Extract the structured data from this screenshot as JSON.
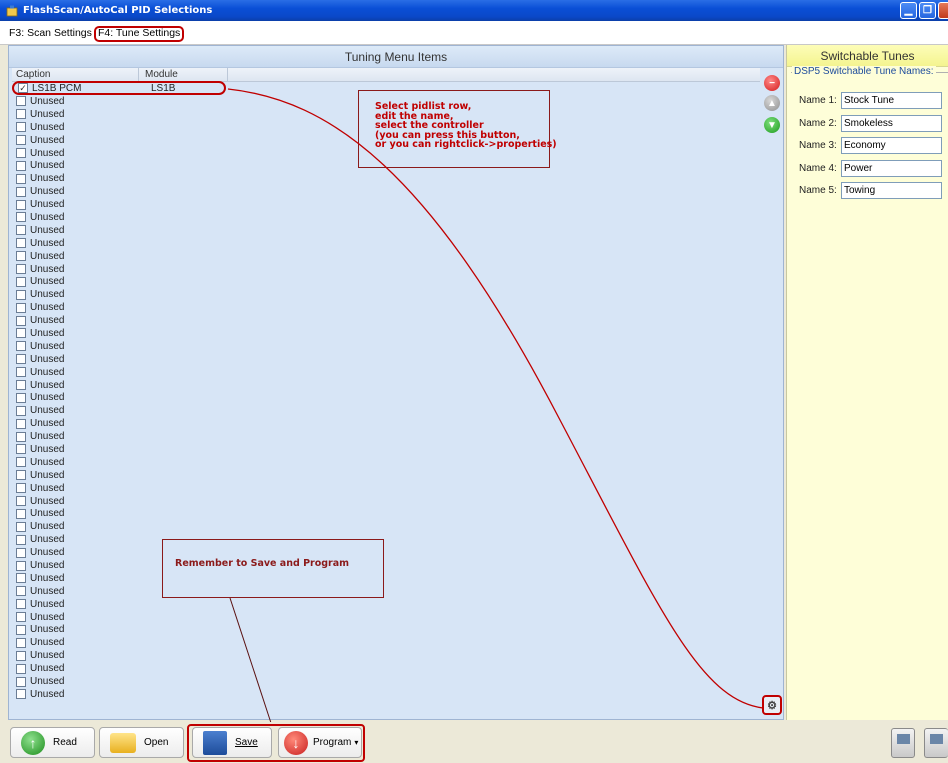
{
  "window": {
    "title": "FlashScan/AutoCal PID Selections"
  },
  "tabs": [
    {
      "label": "F3: Scan Settings"
    },
    {
      "label": "F4: Tune Settings"
    }
  ],
  "tuning_panel": {
    "title": "Tuning Menu Items",
    "columns": [
      "Caption",
      "Module"
    ],
    "rows": [
      {
        "checked": true,
        "caption": "LS1B PCM",
        "module": "LS1B"
      },
      {
        "checked": false,
        "caption": "Unused",
        "module": ""
      },
      {
        "checked": false,
        "caption": "Unused",
        "module": ""
      },
      {
        "checked": false,
        "caption": "Unused",
        "module": ""
      },
      {
        "checked": false,
        "caption": "Unused",
        "module": ""
      },
      {
        "checked": false,
        "caption": "Unused",
        "module": ""
      },
      {
        "checked": false,
        "caption": "Unused",
        "module": ""
      },
      {
        "checked": false,
        "caption": "Unused",
        "module": ""
      },
      {
        "checked": false,
        "caption": "Unused",
        "module": ""
      },
      {
        "checked": false,
        "caption": "Unused",
        "module": ""
      },
      {
        "checked": false,
        "caption": "Unused",
        "module": ""
      },
      {
        "checked": false,
        "caption": "Unused",
        "module": ""
      },
      {
        "checked": false,
        "caption": "Unused",
        "module": ""
      },
      {
        "checked": false,
        "caption": "Unused",
        "module": ""
      },
      {
        "checked": false,
        "caption": "Unused",
        "module": ""
      },
      {
        "checked": false,
        "caption": "Unused",
        "module": ""
      },
      {
        "checked": false,
        "caption": "Unused",
        "module": ""
      },
      {
        "checked": false,
        "caption": "Unused",
        "module": ""
      },
      {
        "checked": false,
        "caption": "Unused",
        "module": ""
      },
      {
        "checked": false,
        "caption": "Unused",
        "module": ""
      },
      {
        "checked": false,
        "caption": "Unused",
        "module": ""
      },
      {
        "checked": false,
        "caption": "Unused",
        "module": ""
      },
      {
        "checked": false,
        "caption": "Unused",
        "module": ""
      },
      {
        "checked": false,
        "caption": "Unused",
        "module": ""
      },
      {
        "checked": false,
        "caption": "Unused",
        "module": ""
      },
      {
        "checked": false,
        "caption": "Unused",
        "module": ""
      },
      {
        "checked": false,
        "caption": "Unused",
        "module": ""
      },
      {
        "checked": false,
        "caption": "Unused",
        "module": ""
      },
      {
        "checked": false,
        "caption": "Unused",
        "module": ""
      },
      {
        "checked": false,
        "caption": "Unused",
        "module": ""
      },
      {
        "checked": false,
        "caption": "Unused",
        "module": ""
      },
      {
        "checked": false,
        "caption": "Unused",
        "module": ""
      },
      {
        "checked": false,
        "caption": "Unused",
        "module": ""
      },
      {
        "checked": false,
        "caption": "Unused",
        "module": ""
      },
      {
        "checked": false,
        "caption": "Unused",
        "module": ""
      },
      {
        "checked": false,
        "caption": "Unused",
        "module": ""
      },
      {
        "checked": false,
        "caption": "Unused",
        "module": ""
      },
      {
        "checked": false,
        "caption": "Unused",
        "module": ""
      },
      {
        "checked": false,
        "caption": "Unused",
        "module": ""
      },
      {
        "checked": false,
        "caption": "Unused",
        "module": ""
      },
      {
        "checked": false,
        "caption": "Unused",
        "module": ""
      },
      {
        "checked": false,
        "caption": "Unused",
        "module": ""
      },
      {
        "checked": false,
        "caption": "Unused",
        "module": ""
      },
      {
        "checked": false,
        "caption": "Unused",
        "module": ""
      },
      {
        "checked": false,
        "caption": "Unused",
        "module": ""
      },
      {
        "checked": false,
        "caption": "Unused",
        "module": ""
      },
      {
        "checked": false,
        "caption": "Unused",
        "module": ""
      },
      {
        "checked": false,
        "caption": "Unused",
        "module": ""
      }
    ]
  },
  "switchable_tunes": {
    "title": "Switchable Tunes",
    "group_label": "DSP5 Switchable Tune Names:",
    "names": [
      {
        "label": "Name 1:",
        "value": "Stock Tune"
      },
      {
        "label": "Name 2:",
        "value": "Smokeless"
      },
      {
        "label": "Name 3:",
        "value": "Economy"
      },
      {
        "label": "Name 4:",
        "value": "Power"
      },
      {
        "label": "Name 5:",
        "value": "Towing"
      }
    ]
  },
  "annotations": {
    "callout_select": "Select pidlist row,\nedit the name,\nselect the controller\n(you can press this button,\nor you can rightclick->properties)",
    "callout_save": "Remember to Save and Program",
    "color": "#c00000"
  },
  "toolbar": {
    "read_label": "Read",
    "open_label": "Open",
    "save_label": "Save",
    "program_label": "Program"
  },
  "icons": {
    "remove": "remove-icon",
    "move_up": "move-up-icon",
    "move_down": "move-down-icon",
    "properties": "properties-icon"
  }
}
